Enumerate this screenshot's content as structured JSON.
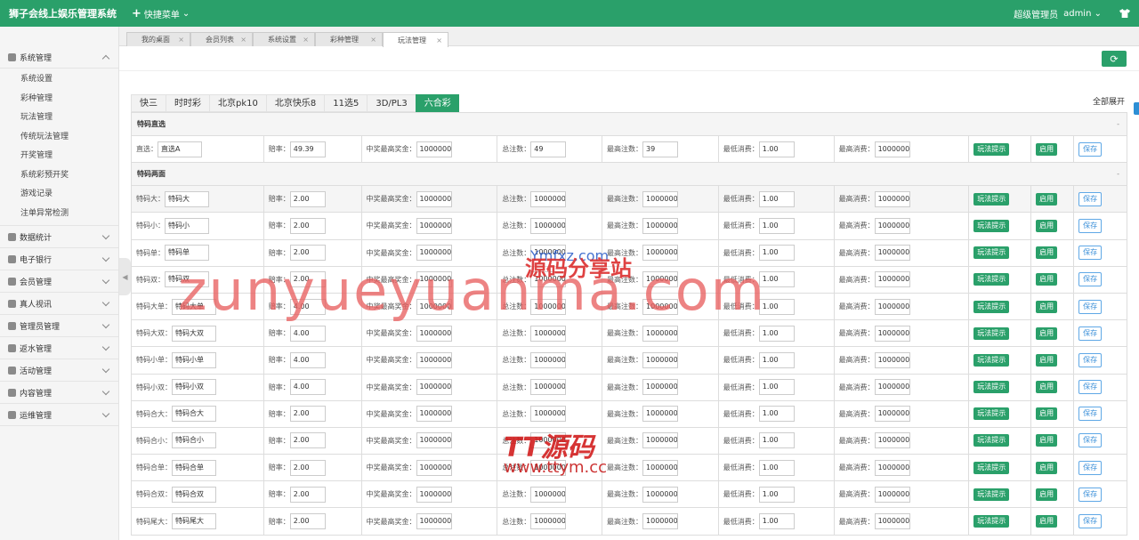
{
  "app": {
    "title": "狮子会线上娱乐管理系统",
    "quick_menu": "快捷菜单",
    "role": "超级管理员",
    "user": "admin"
  },
  "sidebar": {
    "groups": [
      {
        "label": "系统管理",
        "expanded": true,
        "items": [
          "系统设置",
          "彩种管理",
          "玩法管理",
          "传统玩法管理",
          "开奖管理",
          "系统彩预开奖",
          "游戏记录",
          "注单异常检测"
        ]
      },
      {
        "label": "数据统计"
      },
      {
        "label": "电子银行"
      },
      {
        "label": "会员管理"
      },
      {
        "label": "真人视讯"
      },
      {
        "label": "管理员管理"
      },
      {
        "label": "返水管理"
      },
      {
        "label": "活动管理"
      },
      {
        "label": "内容管理"
      },
      {
        "label": "运维管理"
      }
    ]
  },
  "page_tabs": [
    {
      "label": "我的桌面"
    },
    {
      "label": "会员列表"
    },
    {
      "label": "系统设置"
    },
    {
      "label": "彩种管理"
    },
    {
      "label": "玩法管理",
      "active": true
    }
  ],
  "lottery_tabs": [
    "快三",
    "时时彩",
    "北京pk10",
    "北京快乐8",
    "11选5",
    "3D/PL3",
    "六合彩"
  ],
  "active_lottery_tab": "六合彩",
  "expand_all": "全部展开",
  "labels": {
    "odds": "赔率：",
    "max_prize": "中奖最高奖金：",
    "total_bets": "总注数：",
    "max_bets": "最高注数：",
    "min_spend": "最低消费：",
    "max_spend": "最高消费：",
    "hint_btn": "玩法提示",
    "enable_btn": "启用",
    "save_btn": "保存"
  },
  "sections": [
    {
      "title": "特码直选",
      "rows": [
        {
          "name_label": "直选：",
          "name": "直选A",
          "odds": "49.39",
          "max_prize": "10000000",
          "total_bets": "49",
          "max_bets": "39",
          "min_spend": "1.00",
          "max_spend": "10000000"
        }
      ]
    },
    {
      "title": "特码两面",
      "rows": [
        {
          "name_label": "特码大：",
          "name": "特码大",
          "odds": "2.00",
          "max_prize": "1000000.",
          "total_bets": "1000000",
          "max_bets": "1000000",
          "min_spend": "1.00",
          "max_spend": "1000000."
        },
        {
          "name_label": "特码小：",
          "name": "特码小",
          "odds": "2.00",
          "max_prize": "1000000.",
          "total_bets": "1000000",
          "max_bets": "1000000",
          "min_spend": "1.00",
          "max_spend": "1000000."
        },
        {
          "name_label": "特码单：",
          "name": "特码单",
          "odds": "2.00",
          "max_prize": "1000000.",
          "total_bets": "1000000",
          "max_bets": "1000000",
          "min_spend": "1.00",
          "max_spend": "1000000."
        },
        {
          "name_label": "特码双：",
          "name": "特码双",
          "odds": "2.00",
          "max_prize": "1000000.",
          "total_bets": "1000000",
          "max_bets": "1000000",
          "min_spend": "1.00",
          "max_spend": "1000000."
        },
        {
          "name_label": "特码大单：",
          "name": "特码大单",
          "odds": "4.00",
          "max_prize": "1000000.",
          "total_bets": "1000000",
          "max_bets": "1000000",
          "min_spend": "1.00",
          "max_spend": "1000000."
        },
        {
          "name_label": "特码大双：",
          "name": "特码大双",
          "odds": "4.00",
          "max_prize": "1000000.",
          "total_bets": "1000000",
          "max_bets": "1000000",
          "min_spend": "1.00",
          "max_spend": "1000000."
        },
        {
          "name_label": "特码小单：",
          "name": "特码小单",
          "odds": "4.00",
          "max_prize": "1000000.",
          "total_bets": "1000000",
          "max_bets": "1000000",
          "min_spend": "1.00",
          "max_spend": "1000000."
        },
        {
          "name_label": "特码小双：",
          "name": "特码小双",
          "odds": "4.00",
          "max_prize": "1000000.",
          "total_bets": "1000000",
          "max_bets": "1000000",
          "min_spend": "1.00",
          "max_spend": "1000000."
        },
        {
          "name_label": "特码合大：",
          "name": "特码合大",
          "odds": "2.00",
          "max_prize": "1000000.",
          "total_bets": "1000000",
          "max_bets": "1000000",
          "min_spend": "1.00",
          "max_spend": "1000000."
        },
        {
          "name_label": "特码合小：",
          "name": "特码合小",
          "odds": "2.00",
          "max_prize": "1000000.",
          "total_bets": "1000000",
          "max_bets": "1000000",
          "min_spend": "1.00",
          "max_spend": "1000000."
        },
        {
          "name_label": "特码合单：",
          "name": "特码合单",
          "odds": "2.00",
          "max_prize": "1000000.",
          "total_bets": "1000000",
          "max_bets": "1000000",
          "min_spend": "1.00",
          "max_spend": "1000000."
        },
        {
          "name_label": "特码合双：",
          "name": "特码合双",
          "odds": "2.00",
          "max_prize": "1000000.",
          "total_bets": "1000000",
          "max_bets": "1000000",
          "min_spend": "1.00",
          "max_spend": "1000000."
        },
        {
          "name_label": "特码尾大：",
          "name": "特码尾大",
          "odds": "2.00",
          "max_prize": "1000000.",
          "total_bets": "1000000",
          "max_bets": "1000000",
          "min_spend": "1.00",
          "max_spend": "1000000."
        }
      ]
    }
  ],
  "watermarks": {
    "w1": "zunyueyuanma.com",
    "w2": "源码分享站",
    "w2b": "Ymfxz.com",
    "w3": "TT源码",
    "w4": "www.ttym.cc"
  }
}
